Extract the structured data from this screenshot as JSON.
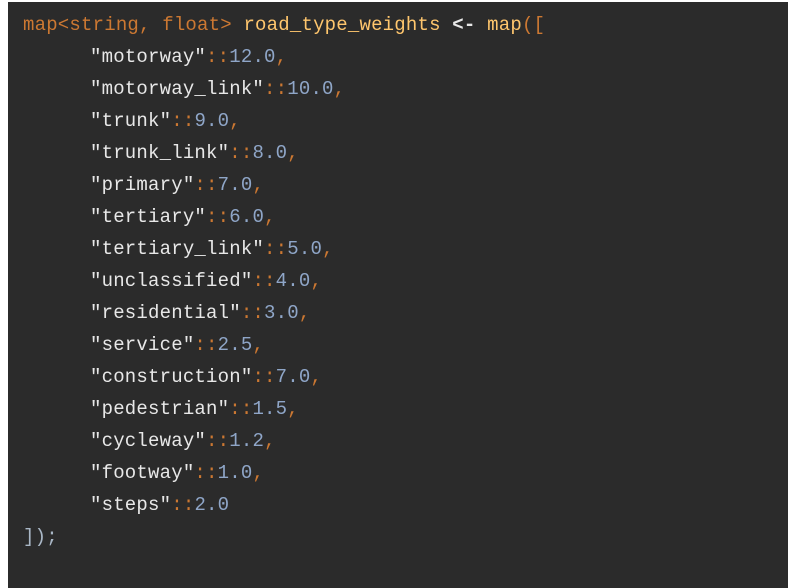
{
  "code": {
    "header": {
      "type_decl": "map<string, float>",
      "var_name": "road_type_weights",
      "assign_op": "<-",
      "ctor": "map",
      "open": "(["
    },
    "entries": [
      {
        "key": "\"motorway\"",
        "sep": "::",
        "value": "12.0",
        "comma": ","
      },
      {
        "key": "\"motorway_link\"",
        "sep": "::",
        "value": "10.0",
        "comma": ","
      },
      {
        "key": "\"trunk\"",
        "sep": "::",
        "value": "9.0",
        "comma": ","
      },
      {
        "key": "\"trunk_link\"",
        "sep": "::",
        "value": "8.0",
        "comma": ","
      },
      {
        "key": "\"primary\"",
        "sep": "::",
        "value": "7.0",
        "comma": ","
      },
      {
        "key": "\"tertiary\"",
        "sep": "::",
        "value": "6.0",
        "comma": ","
      },
      {
        "key": "\"tertiary_link\"",
        "sep": "::",
        "value": "5.0",
        "comma": ","
      },
      {
        "key": "\"unclassified\"",
        "sep": "::",
        "value": "4.0",
        "comma": ","
      },
      {
        "key": "\"residential\"",
        "sep": "::",
        "value": "3.0",
        "comma": ","
      },
      {
        "key": "\"service\"",
        "sep": "::",
        "value": "2.5",
        "comma": ","
      },
      {
        "key": "\"construction\"",
        "sep": "::",
        "value": "7.0",
        "comma": ","
      },
      {
        "key": "\"pedestrian\"",
        "sep": "::",
        "value": "1.5",
        "comma": ","
      },
      {
        "key": "\"cycleway\"",
        "sep": "::",
        "value": "1.2",
        "comma": ","
      },
      {
        "key": "\"footway\"",
        "sep": "::",
        "value": "1.0",
        "comma": ","
      },
      {
        "key": "\"steps\"",
        "sep": "::",
        "value": "2.0",
        "comma": ""
      }
    ],
    "footer": "]);"
  },
  "colors": {
    "background": "#2b2b2b",
    "keyword": "#cc7832",
    "type_name": "#ffc66d",
    "string": "#e8e8e8",
    "number": "#8fa6c8"
  }
}
